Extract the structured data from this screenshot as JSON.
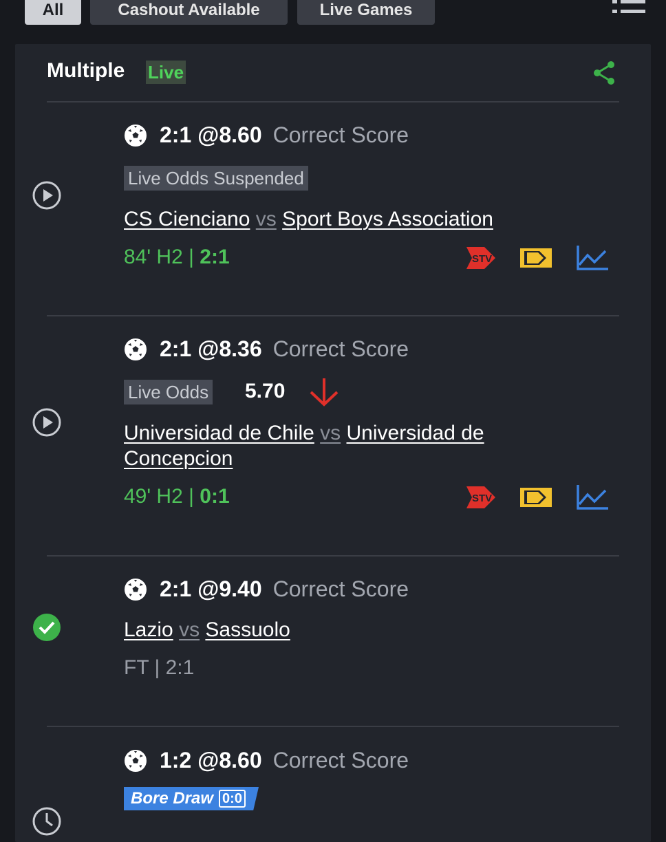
{
  "filters": [
    "All",
    "Cashout Available",
    "Live Games"
  ],
  "header": {
    "title": "Multiple",
    "live_badge": "Live"
  },
  "selections": [
    {
      "score": "2:1",
      "odds": "@8.60",
      "market": "Correct Score",
      "tag": "Live Odds Suspended",
      "home": "CS Cienciano",
      "vs": "vs",
      "away": "Sport Boys Association",
      "status_prefix": "84' H2 |",
      "status_score": "2:1",
      "state": "play-icon"
    },
    {
      "score": "2:1",
      "odds": "@8.36",
      "market": "Correct Score",
      "tag": "Live Odds",
      "live_odds_value": "5.70",
      "home": "Universidad de Chile",
      "vs": "vs",
      "away": "Universidad de Concepcion",
      "status_prefix": "49' H2 |",
      "status_score": "0:1",
      "state": "play-icon"
    },
    {
      "score": "2:1",
      "odds": "@9.40",
      "market": "Correct Score",
      "home": "Lazio",
      "vs": "vs",
      "away": "Sassuolo",
      "status_prefix": "FT | 2:1",
      "state": "check-icon"
    },
    {
      "score": "1:2",
      "odds": "@8.60",
      "market": "Correct Score",
      "promo_label": "Bore Draw",
      "promo_score": "0:0",
      "state": "clock-icon"
    }
  ],
  "colors": {
    "green": "#4fc25a",
    "red": "#e0302a",
    "yellow": "#f2c12e",
    "blue": "#3c82e0"
  }
}
